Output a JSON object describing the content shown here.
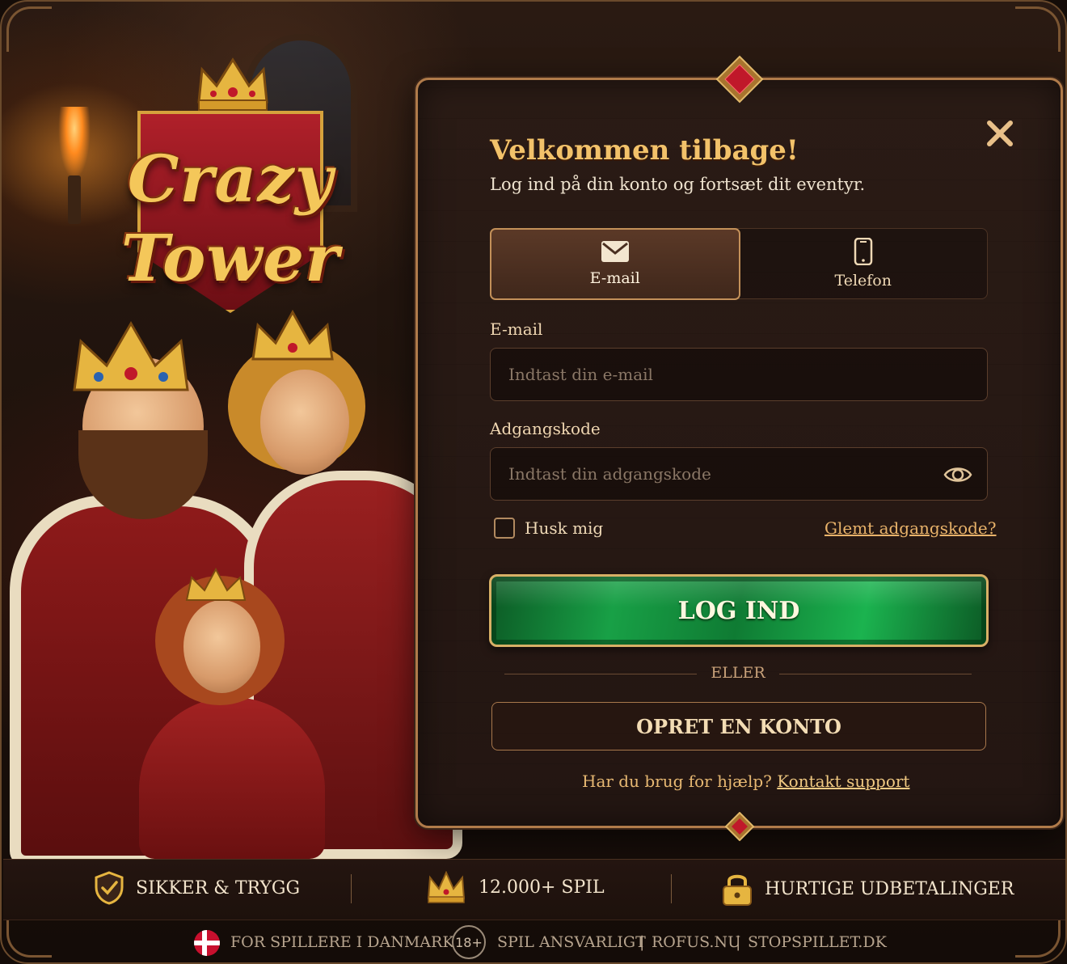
{
  "logo": {
    "line1": "Crazy",
    "line2": "Tower"
  },
  "login": {
    "title": "Velkommen tilbage!",
    "subtitle": "Log ind på din konto og fortsæt dit eventyr.",
    "tabs": [
      {
        "label": "E-mail",
        "icon": "envelope-icon",
        "active": true
      },
      {
        "label": "Telefon",
        "icon": "phone-icon",
        "active": false
      }
    ],
    "email_label": "E-mail",
    "email_placeholder": "Indtast din e-mail",
    "password_label": "Adgangskode",
    "password_placeholder": "Indtast din adgangskode",
    "remember_label": "Husk mig",
    "forgot_label": "Glemt adgangskode?",
    "login_button": "LOG IND",
    "or_label": "ELLER",
    "create_button": "OPRET EN KONTO",
    "help_text": "Har du brug for hjælp?",
    "help_link": "Kontakt support"
  },
  "features": [
    {
      "label": "SIKKER & TRYGG",
      "icon": "shield-check-icon"
    },
    {
      "label": "12.000+ SPIL",
      "icon": "crown-icon"
    },
    {
      "label": "HURTIGE UDBETALINGER",
      "icon": "padlock-icon"
    }
  ],
  "footer": {
    "country": "FOR SPILLERE I DANMARK",
    "age_badge": "18+",
    "responsible": "SPIL ANSVARLIGT",
    "rofus": "ROFUS.NU",
    "stopspillet": "STOPSPILLET.DK",
    "separator": "|"
  },
  "colors": {
    "accent_gold": "#f2c26a",
    "login_green": "#18a046",
    "panel_border": "#b07b4a",
    "background": "#1c110b"
  }
}
